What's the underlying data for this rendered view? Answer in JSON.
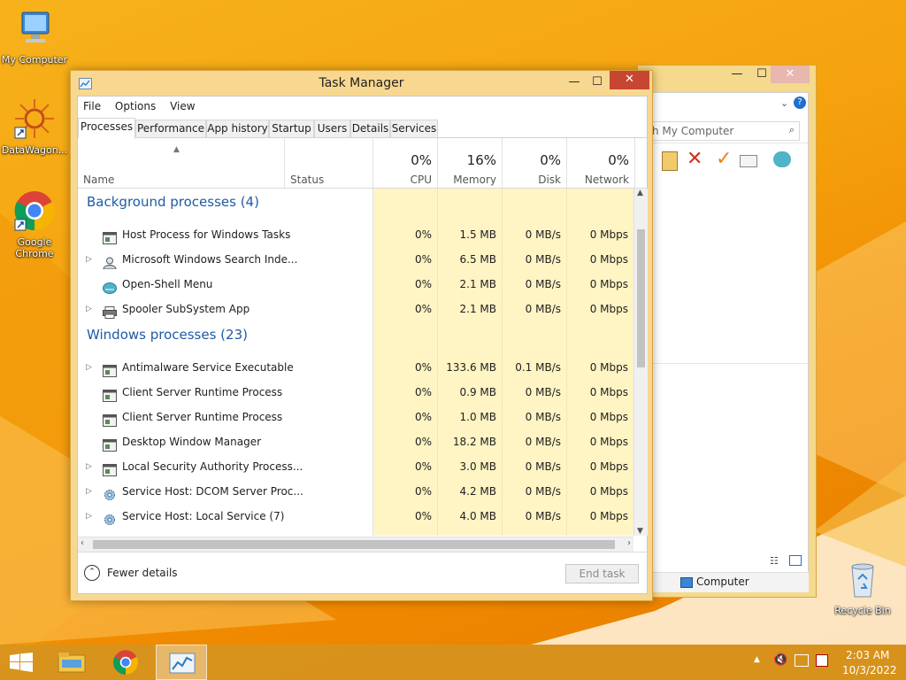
{
  "desktop": {
    "icons": [
      {
        "label": "My Computer"
      },
      {
        "label": "DataWagon..."
      },
      {
        "label": "Google Chrome"
      },
      {
        "label": "Recycle Bin"
      }
    ]
  },
  "explorer": {
    "search_placeholder": "h My Computer",
    "status_item": "Computer",
    "close_glyph": "✕",
    "max_glyph": "☐",
    "min_glyph": "—"
  },
  "task_manager": {
    "title": "Task Manager",
    "menu": [
      "File",
      "Options",
      "View"
    ],
    "tabs": [
      "Processes",
      "Performance",
      "App history",
      "Startup",
      "Users",
      "Details",
      "Services"
    ],
    "active_tab": "Processes",
    "columns": {
      "name": "Name",
      "status": "Status",
      "cpu": {
        "percent": "0%",
        "label": "CPU"
      },
      "memory": {
        "percent": "16%",
        "label": "Memory"
      },
      "disk": {
        "percent": "0%",
        "label": "Disk"
      },
      "network": {
        "percent": "0%",
        "label": "Network"
      }
    },
    "groups": [
      {
        "title": "Background processes (4)",
        "rows": [
          {
            "name": "Host Process for Windows Tasks",
            "expandable": false,
            "icon": "app-window-icon",
            "cpu": "0%",
            "memory": "1.5 MB",
            "disk": "0 MB/s",
            "network": "0 Mbps"
          },
          {
            "name": "Microsoft Windows Search Inde...",
            "expandable": true,
            "icon": "search-user-icon",
            "cpu": "0%",
            "memory": "6.5 MB",
            "disk": "0 MB/s",
            "network": "0 Mbps"
          },
          {
            "name": "Open-Shell Menu",
            "expandable": false,
            "icon": "shell-icon",
            "cpu": "0%",
            "memory": "2.1 MB",
            "disk": "0 MB/s",
            "network": "0 Mbps"
          },
          {
            "name": "Spooler SubSystem App",
            "expandable": true,
            "icon": "printer-icon",
            "cpu": "0%",
            "memory": "2.1 MB",
            "disk": "0 MB/s",
            "network": "0 Mbps"
          }
        ]
      },
      {
        "title": "Windows processes (23)",
        "rows": [
          {
            "name": "Antimalware Service Executable",
            "expandable": true,
            "icon": "app-window-icon",
            "cpu": "0%",
            "memory": "133.6 MB",
            "disk": "0.1 MB/s",
            "network": "0 Mbps"
          },
          {
            "name": "Client Server Runtime Process",
            "expandable": false,
            "icon": "app-window-icon",
            "cpu": "0%",
            "memory": "0.9 MB",
            "disk": "0 MB/s",
            "network": "0 Mbps"
          },
          {
            "name": "Client Server Runtime Process",
            "expandable": false,
            "icon": "app-window-icon",
            "cpu": "0%",
            "memory": "1.0 MB",
            "disk": "0 MB/s",
            "network": "0 Mbps"
          },
          {
            "name": "Desktop Window Manager",
            "expandable": false,
            "icon": "app-window-icon",
            "cpu": "0%",
            "memory": "18.2 MB",
            "disk": "0 MB/s",
            "network": "0 Mbps"
          },
          {
            "name": "Local Security Authority Process...",
            "expandable": true,
            "icon": "app-window-icon",
            "cpu": "0%",
            "memory": "3.0 MB",
            "disk": "0 MB/s",
            "network": "0 Mbps"
          },
          {
            "name": "Service Host: DCOM Server Proc...",
            "expandable": true,
            "icon": "gear-icon",
            "cpu": "0%",
            "memory": "4.2 MB",
            "disk": "0 MB/s",
            "network": "0 Mbps"
          },
          {
            "name": "Service Host: Local Service (7)",
            "expandable": true,
            "icon": "gear-icon",
            "cpu": "0%",
            "memory": "4.0 MB",
            "disk": "0 MB/s",
            "network": "0 Mbps"
          }
        ]
      }
    ],
    "fewer_details": "Fewer details",
    "end_task": "End task"
  },
  "taskbar": {
    "time": "2:03 AM",
    "date": "10/3/2022"
  },
  "colors": {
    "desktop": "#f5a20e",
    "window_frame": "#f8d890",
    "heat_column": "#fff4c4",
    "group_title": "#1f5ba6",
    "close_button": "#c74632"
  }
}
